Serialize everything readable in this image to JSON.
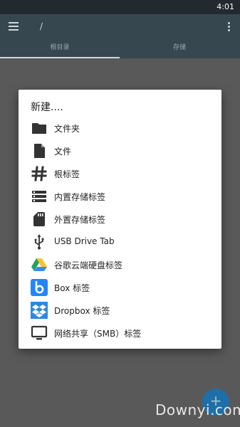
{
  "status_bar": {
    "time": "4:01"
  },
  "app_bar": {
    "path": "/"
  },
  "tabs": [
    {
      "label": "根目录",
      "selected": true
    },
    {
      "label": "存储",
      "selected": false
    }
  ],
  "dialog": {
    "title": "新建....",
    "items": [
      {
        "label": "文件夹",
        "icon": "folder-icon"
      },
      {
        "label": "文件",
        "icon": "file-icon"
      },
      {
        "label": "根标签",
        "icon": "hash-icon"
      },
      {
        "label": "内置存储标签",
        "icon": "storage-icon"
      },
      {
        "label": "外置存储标签",
        "icon": "sd-card-icon"
      },
      {
        "label": "USB Drive Tab",
        "icon": "usb-icon"
      },
      {
        "label": "谷歌云端硬盘标签",
        "icon": "google-drive-icon"
      },
      {
        "label": "Box 标签",
        "icon": "box-icon"
      },
      {
        "label": "Dropbox 标签",
        "icon": "dropbox-icon"
      },
      {
        "label": "网络共享（SMB）标签",
        "icon": "monitor-icon"
      }
    ]
  },
  "fab": {
    "glyph": "+"
  },
  "watermark": "Downyi.com",
  "colors": {
    "app_bar": "#37474f",
    "status_bar": "#222a2f",
    "scrim": "#595959",
    "fab": "#1e6fa8",
    "icon": "#333333",
    "drive_yellow": "#f7c431",
    "drive_green": "#1fa463",
    "drive_blue": "#4285f4",
    "box_blue": "#2486fc",
    "dropbox_blue": "#2e87e0"
  }
}
